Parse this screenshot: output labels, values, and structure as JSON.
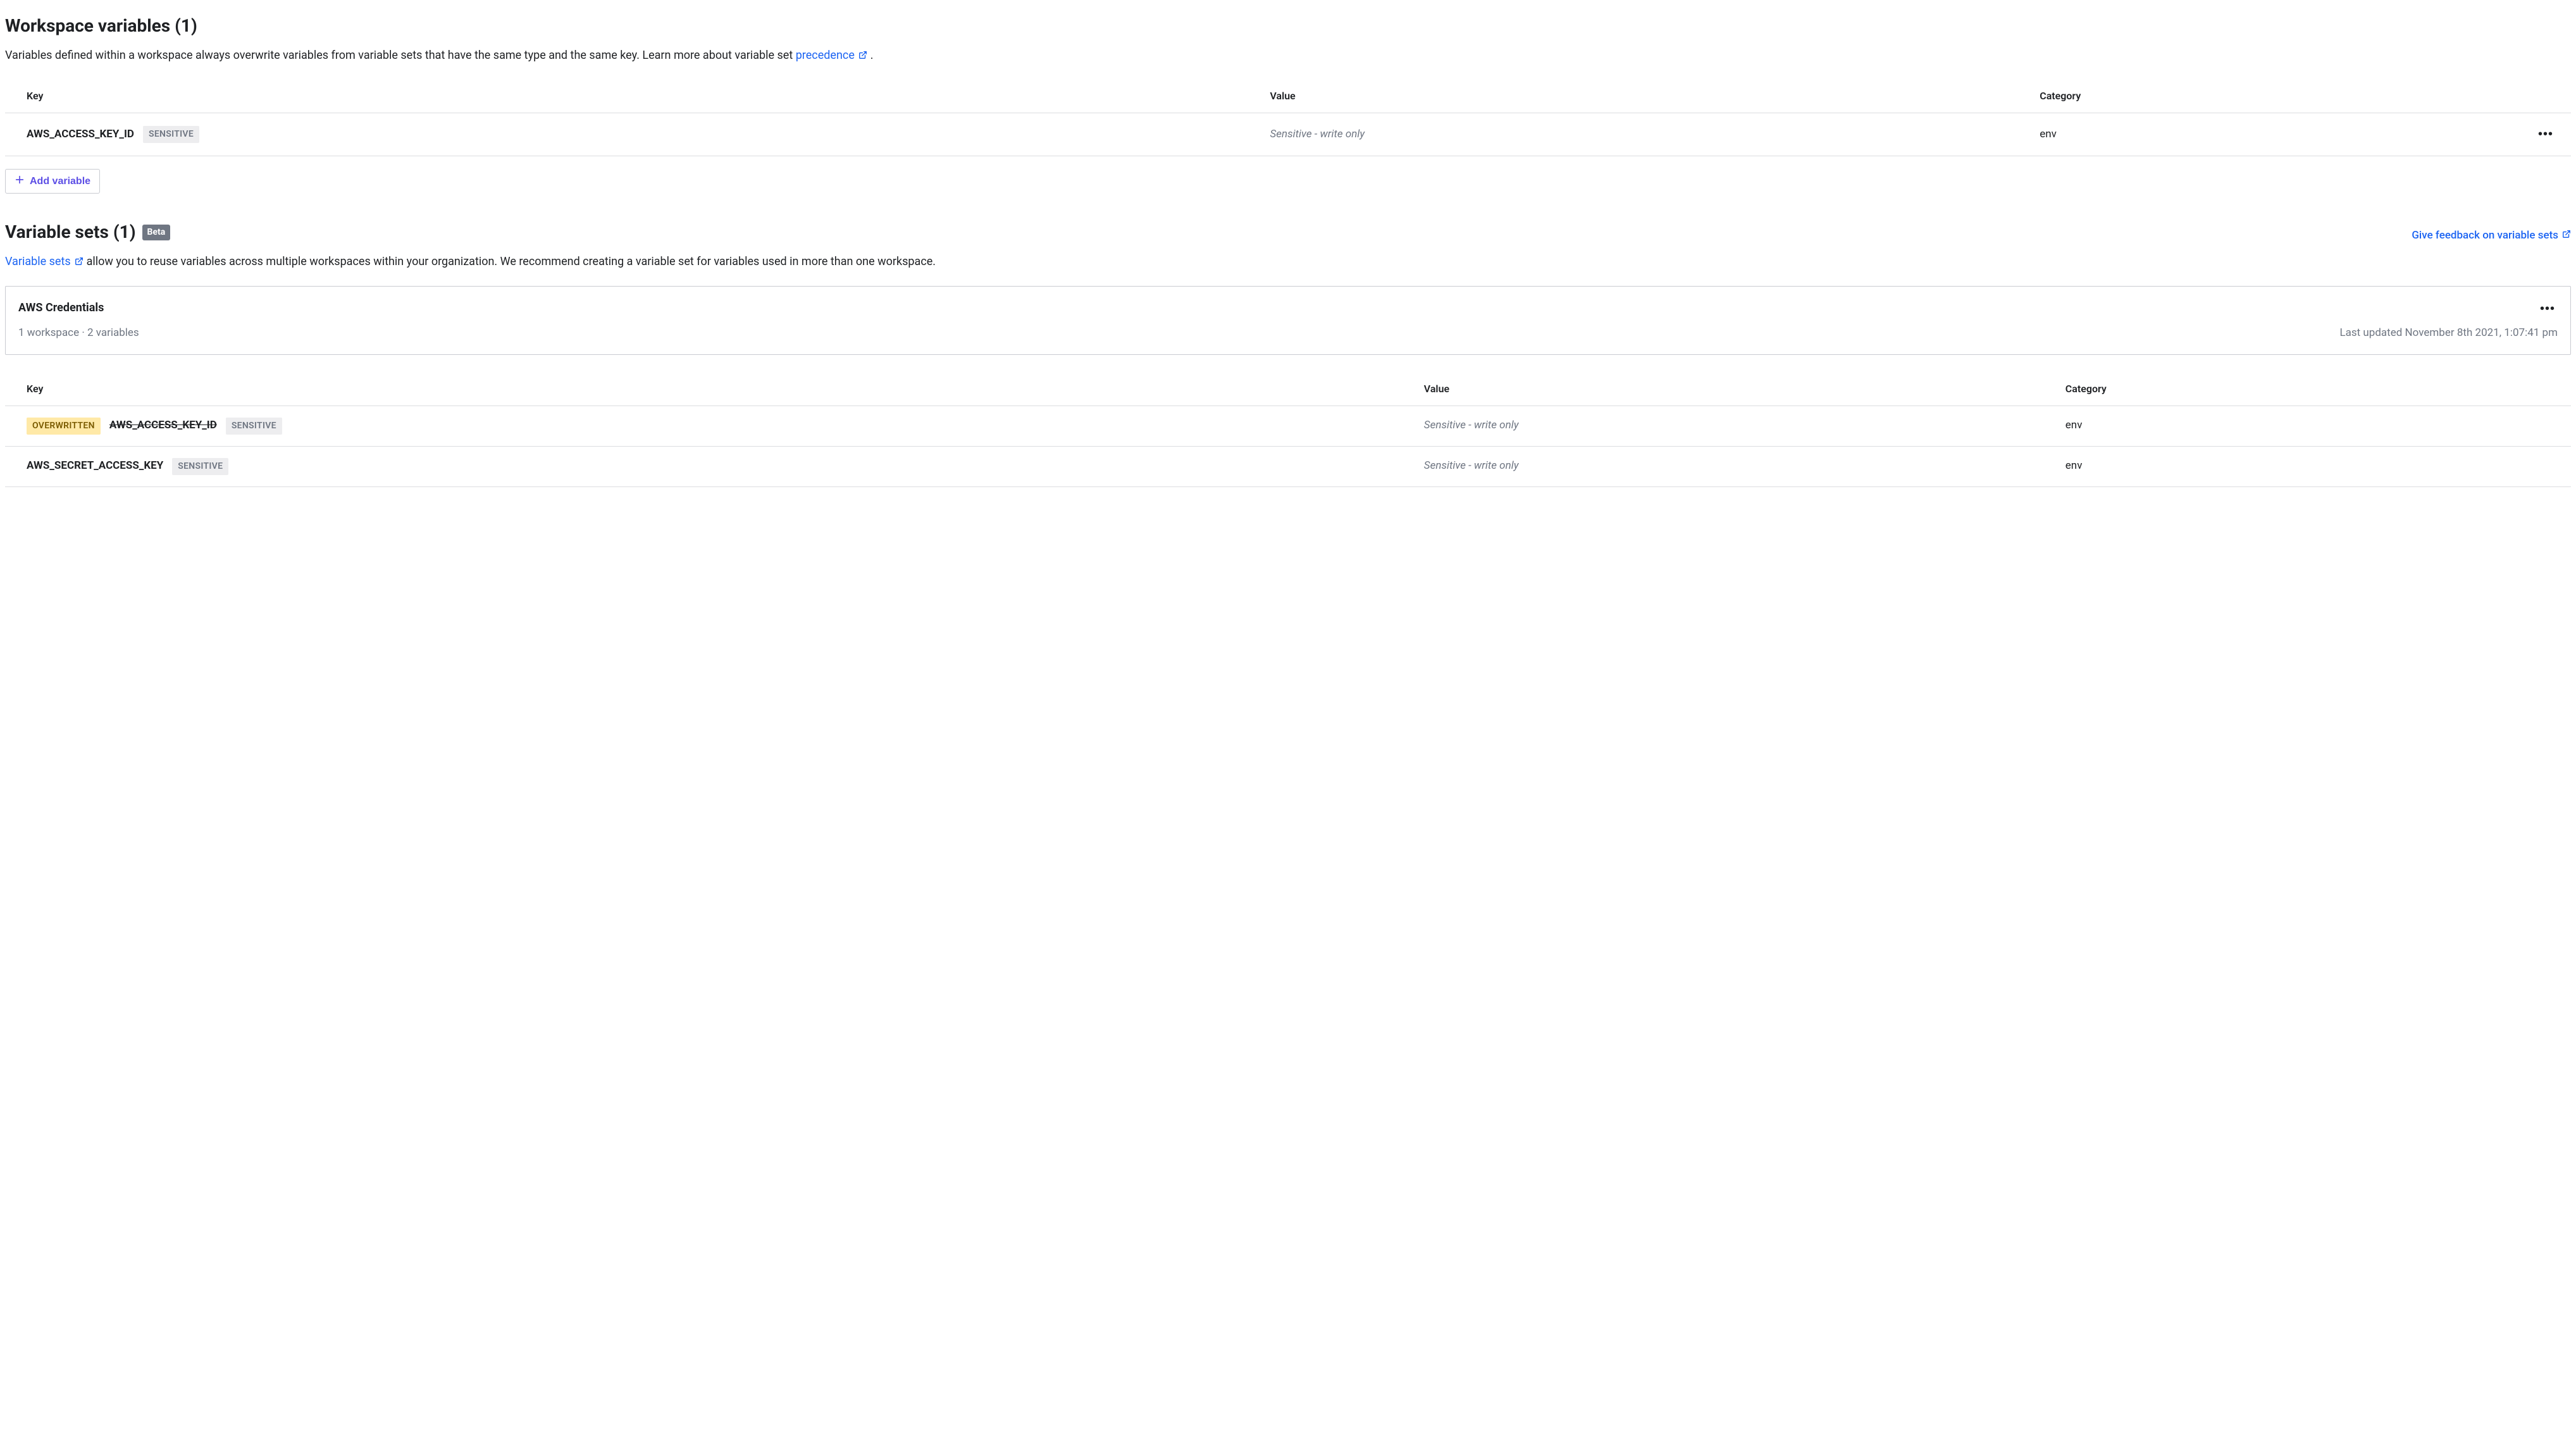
{
  "workspace_vars": {
    "heading": "Workspace variables (1)",
    "description_pre": "Variables defined within a workspace always overwrite variables from variable sets that have the same type and the same key. Learn more about variable set ",
    "description_link": "precedence",
    "description_post": ".",
    "columns": {
      "key": "Key",
      "value": "Value",
      "category": "Category"
    },
    "rows": [
      {
        "key": "AWS_ACCESS_KEY_ID",
        "sensitive_badge": "SENSITIVE",
        "value": "Sensitive - write only",
        "category": "env"
      }
    ],
    "add_button": "Add variable"
  },
  "variable_sets": {
    "heading": "Variable sets (1)",
    "beta_badge": "Beta",
    "feedback_link": "Give feedback on variable sets",
    "description_link": "Variable sets",
    "description_post": " allow you to reuse variables across multiple workspaces within your organization. We recommend creating a variable set for variables used in more than one workspace.",
    "card": {
      "title": "AWS Credentials",
      "meta": "1 workspace  ·  2 variables",
      "last_updated": "Last updated November 8th 2021, 1:07:41 pm"
    },
    "columns": {
      "key": "Key",
      "value": "Value",
      "category": "Category"
    },
    "rows": [
      {
        "overwritten_badge": "OVERWRITTEN",
        "key": "AWS_ACCESS_KEY_ID",
        "struck": true,
        "sensitive_badge": "SENSITIVE",
        "value": "Sensitive - write only",
        "category": "env"
      },
      {
        "key": "AWS_SECRET_ACCESS_KEY",
        "sensitive_badge": "SENSITIVE",
        "value": "Sensitive - write only",
        "category": "env"
      }
    ]
  }
}
